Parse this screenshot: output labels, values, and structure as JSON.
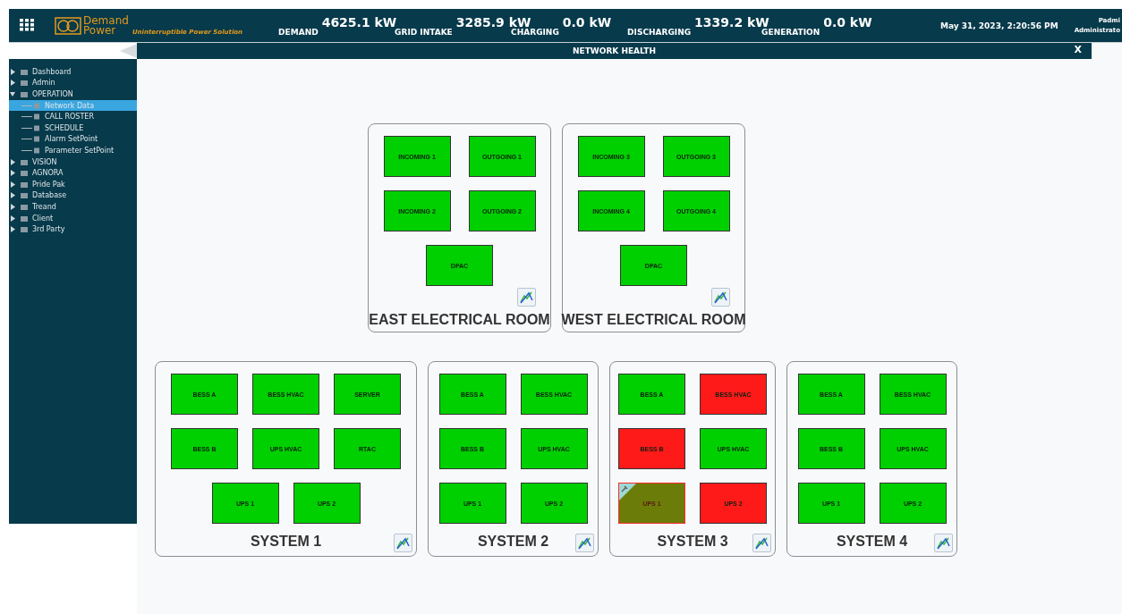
{
  "header": {
    "logo_line1": "Demand",
    "logo_line2": "Power",
    "tagline": "Uninterruptible Power Solution",
    "metrics": [
      {
        "label": "DEMAND",
        "value": "4625.1 kW"
      },
      {
        "label": "GRID INTAKE",
        "value": "3285.9 kW"
      },
      {
        "label": "CHARGING",
        "value": "0.0 kW"
      },
      {
        "label": "DISCHARGING",
        "value": "1339.2 kW"
      },
      {
        "label": "GENERATION",
        "value": "0.0 kW"
      }
    ],
    "datetime": "May 31, 2023, 2:20:56 PM",
    "user_name": "Padmi",
    "user_role": "Administrato"
  },
  "title_bar": {
    "title": "NETWORK HEALTH",
    "close": "X"
  },
  "sidebar": {
    "items": [
      {
        "label": "Dashboard",
        "expanded": false,
        "selected": false
      },
      {
        "label": "Admin",
        "expanded": false,
        "selected": false
      },
      {
        "label": "OPERATION",
        "expanded": true,
        "selected": false,
        "children": [
          {
            "label": "Network Data",
            "selected": true
          },
          {
            "label": "CALL ROSTER",
            "selected": false
          },
          {
            "label": "SCHEDULE",
            "selected": false
          },
          {
            "label": "Alarm SetPoint",
            "selected": false
          },
          {
            "label": "Parameter SetPoint",
            "selected": false
          }
        ]
      },
      {
        "label": "VISION",
        "expanded": false,
        "selected": false
      },
      {
        "label": "AGNORA",
        "expanded": false,
        "selected": false
      },
      {
        "label": "Pride Pak",
        "expanded": false,
        "selected": false
      },
      {
        "label": "Database",
        "expanded": false,
        "selected": false
      },
      {
        "label": "Treand",
        "expanded": false,
        "selected": false
      },
      {
        "label": "Client",
        "expanded": false,
        "selected": false
      },
      {
        "label": "3rd Party",
        "expanded": false,
        "selected": false
      }
    ]
  },
  "rooms": [
    {
      "title": "EAST ELECTRICAL ROOM",
      "units": [
        {
          "label": "INCOMING 1",
          "color": "#00d000",
          "flagged": false
        },
        {
          "label": "OUTGOING 1",
          "color": "#00d000",
          "flagged": false
        },
        {
          "label": "INCOMING 2",
          "color": "#00d000",
          "flagged": false
        },
        {
          "label": "OUTGOING 2",
          "color": "#00d000",
          "flagged": false
        },
        {
          "label": "DPAC",
          "color": "#00d000",
          "flagged": false
        }
      ]
    },
    {
      "title": "WEST ELECTRICAL ROOM",
      "units": [
        {
          "label": "INCOMING 3",
          "color": "#00d000",
          "flagged": false
        },
        {
          "label": "OUTGOING 3",
          "color": "#00d000",
          "flagged": false
        },
        {
          "label": "INCOMING 4",
          "color": "#00d000",
          "flagged": false
        },
        {
          "label": "OUTGOING 4",
          "color": "#00d000",
          "flagged": false
        },
        {
          "label": "DPAC",
          "color": "#00d000",
          "flagged": false
        }
      ]
    }
  ],
  "systems": [
    {
      "title": "SYSTEM 1",
      "units": [
        {
          "label": "BESS A",
          "color": "#00d000",
          "flagged": false
        },
        {
          "label": "BESS HVAC",
          "color": "#00d000",
          "flagged": false
        },
        {
          "label": "SERVER",
          "color": "#00d000",
          "flagged": false
        },
        {
          "label": "BESS B",
          "color": "#00d000",
          "flagged": false
        },
        {
          "label": "UPS HVAC",
          "color": "#00d000",
          "flagged": false
        },
        {
          "label": "RTAC",
          "color": "#00d000",
          "flagged": false
        },
        {
          "label": "UPS 1",
          "color": "#00d000",
          "flagged": false
        },
        {
          "label": "UPS 2",
          "color": "#00d000",
          "flagged": false
        }
      ]
    },
    {
      "title": "SYSTEM 2",
      "units": [
        {
          "label": "BESS A",
          "color": "#00d000",
          "flagged": false
        },
        {
          "label": "BESS HVAC",
          "color": "#00d000",
          "flagged": false
        },
        {
          "label": "BESS B",
          "color": "#00d000",
          "flagged": false
        },
        {
          "label": "UPS HVAC",
          "color": "#00d000",
          "flagged": false
        },
        {
          "label": "UPS 1",
          "color": "#00d000",
          "flagged": false
        },
        {
          "label": "UPS 2",
          "color": "#00d000",
          "flagged": false
        }
      ]
    },
    {
      "title": "SYSTEM 3",
      "units": [
        {
          "label": "BESS A",
          "color": "#00d000",
          "flagged": false
        },
        {
          "label": "BESS HVAC",
          "color": "#ff1a1a",
          "flagged": false
        },
        {
          "label": "BESS B",
          "color": "#ff1a1a",
          "flagged": false
        },
        {
          "label": "UPS HVAC",
          "color": "#00d000",
          "flagged": false
        },
        {
          "label": "UPS 1",
          "color": "#6b7d08",
          "flagged": true
        },
        {
          "label": "UPS 2",
          "color": "#ff1a1a",
          "flagged": false
        }
      ]
    },
    {
      "title": "SYSTEM 4",
      "units": [
        {
          "label": "BESS A",
          "color": "#00d000",
          "flagged": false
        },
        {
          "label": "BESS HVAC",
          "color": "#00d000",
          "flagged": false
        },
        {
          "label": "BESS B",
          "color": "#00d000",
          "flagged": false
        },
        {
          "label": "UPS HVAC",
          "color": "#00d000",
          "flagged": false
        },
        {
          "label": "UPS 1",
          "color": "#00d000",
          "flagged": false
        },
        {
          "label": "UPS 2",
          "color": "#00d000",
          "flagged": false
        }
      ]
    }
  ]
}
